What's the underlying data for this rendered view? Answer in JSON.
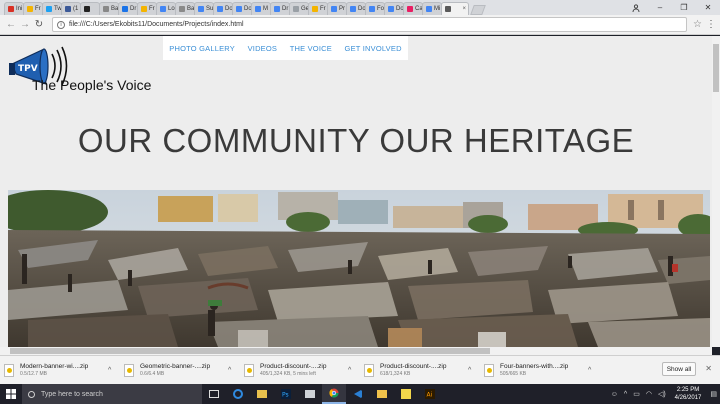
{
  "browser": {
    "tabs": [
      {
        "label": "Ini",
        "color": "#d93025"
      },
      {
        "label": "Fr",
        "color": "#f4b400"
      },
      {
        "label": "Tw",
        "color": "#1da1f2"
      },
      {
        "label": "(1",
        "color": "#3b5998"
      },
      {
        "label": "",
        "color": "#222222"
      },
      {
        "label": "Ba",
        "color": "#888888"
      },
      {
        "label": "Dr",
        "color": "#1a73e8"
      },
      {
        "label": "Fr",
        "color": "#f4b400"
      },
      {
        "label": "Lo",
        "color": "#4285f4"
      },
      {
        "label": "Ba",
        "color": "#8a8a8a"
      },
      {
        "label": "Su",
        "color": "#4285f4"
      },
      {
        "label": "Do",
        "color": "#4285f4"
      },
      {
        "label": "Do",
        "color": "#4285f4"
      },
      {
        "label": "M",
        "color": "#4285f4"
      },
      {
        "label": "Dr",
        "color": "#4285f4"
      },
      {
        "label": "Ge",
        "color": "#9aa0a6"
      },
      {
        "label": "Fr",
        "color": "#f4b400"
      },
      {
        "label": "Pr",
        "color": "#4285f4"
      },
      {
        "label": "Do",
        "color": "#4285f4"
      },
      {
        "label": "Fo",
        "color": "#4285f4"
      },
      {
        "label": "Do",
        "color": "#4285f4"
      },
      {
        "label": "Ca",
        "color": "#e91e63"
      },
      {
        "label": "Mi",
        "color": "#4285f4"
      }
    ],
    "active_tab_color": "#5a5a5a",
    "address": "file:///C:/Users/Ekobits11/Documents/Projects/index.html"
  },
  "site": {
    "nav": [
      "PHOTO GALLERY",
      "VIDEOS",
      "THE VOICE",
      "GET INVOLVED"
    ],
    "logo_initials": "TPV",
    "brand": "The People's Voice",
    "headline": "OUR COMMUNITY OUR HERITAGE"
  },
  "downloads": {
    "items": [
      {
        "name": "Modern-banner-wi....zip",
        "size": "0.5/12.7 MB"
      },
      {
        "name": "Geometric-banner-....zip",
        "size": "0.6/6.4 MB"
      },
      {
        "name": "Product-discount-....zip",
        "size": "405/1,324 KB, 5 mins left"
      },
      {
        "name": "Product-discount-....zip",
        "size": "618/1,324 KB"
      },
      {
        "name": "Four-banners-with....zip",
        "size": "505/665 KB"
      }
    ],
    "show_all": "Show all"
  },
  "taskbar": {
    "search_placeholder": "Type here to search",
    "time": "2:25 PM",
    "date": "4/26/2017"
  }
}
